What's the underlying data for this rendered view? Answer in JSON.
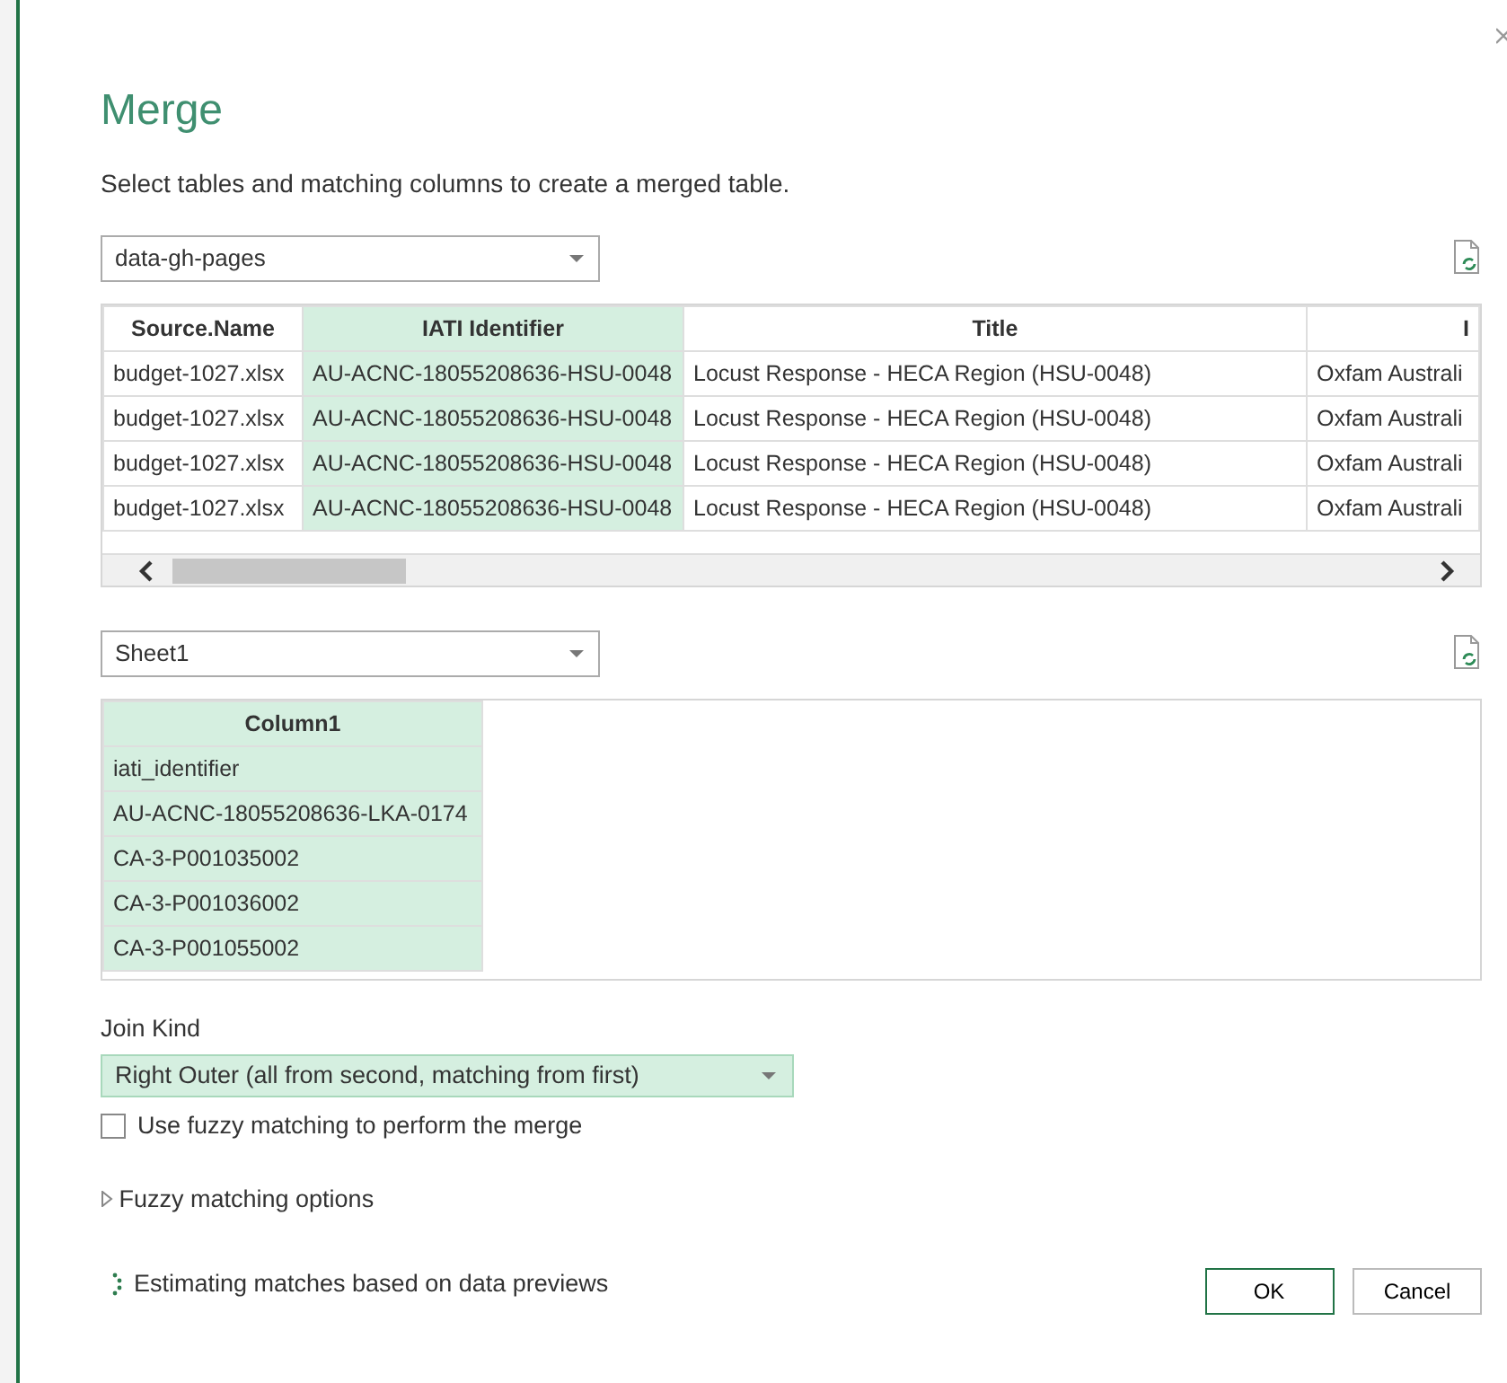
{
  "title": "Merge",
  "subtitle": "Select tables and matching columns to create a merged table.",
  "first_table": {
    "source": "data-gh-pages",
    "columns": [
      {
        "heading": "Source.Name",
        "selected": false
      },
      {
        "heading": "IATI Identifier",
        "selected": true
      },
      {
        "heading": "Title",
        "selected": false
      },
      {
        "heading": "I",
        "selected": false
      }
    ],
    "rows": [
      [
        "budget-1027.xlsx",
        "AU-ACNC-18055208636-HSU-0048",
        "Locust Response - HECA Region (HSU-0048)",
        "Oxfam Australi"
      ],
      [
        "budget-1027.xlsx",
        "AU-ACNC-18055208636-HSU-0048",
        "Locust Response - HECA Region (HSU-0048)",
        "Oxfam Australi"
      ],
      [
        "budget-1027.xlsx",
        "AU-ACNC-18055208636-HSU-0048",
        "Locust Response - HECA Region (HSU-0048)",
        "Oxfam Australi"
      ],
      [
        "budget-1027.xlsx",
        "AU-ACNC-18055208636-HSU-0048",
        "Locust Response - HECA Region (HSU-0048)",
        "Oxfam Australi"
      ]
    ]
  },
  "second_table": {
    "source": "Sheet1",
    "columns": [
      {
        "heading": "Column1",
        "selected": true
      }
    ],
    "rows": [
      [
        "iati_identifier"
      ],
      [
        "AU-ACNC-18055208636-LKA-0174"
      ],
      [
        "CA-3-P001035002"
      ],
      [
        "CA-3-P001036002"
      ],
      [
        "CA-3-P001055002"
      ]
    ]
  },
  "join_kind": {
    "label": "Join Kind",
    "value": "Right Outer (all from second, matching from first)"
  },
  "fuzzy": {
    "label": "Use fuzzy matching to perform the merge",
    "checked": false
  },
  "fuzzy_options": {
    "label": "Fuzzy matching options",
    "expanded": false
  },
  "status": "Estimating matches based on data previews",
  "buttons": [
    {
      "label": "OK",
      "kind": "primary"
    },
    {
      "label": "Cancel",
      "kind": "secondary"
    }
  ]
}
